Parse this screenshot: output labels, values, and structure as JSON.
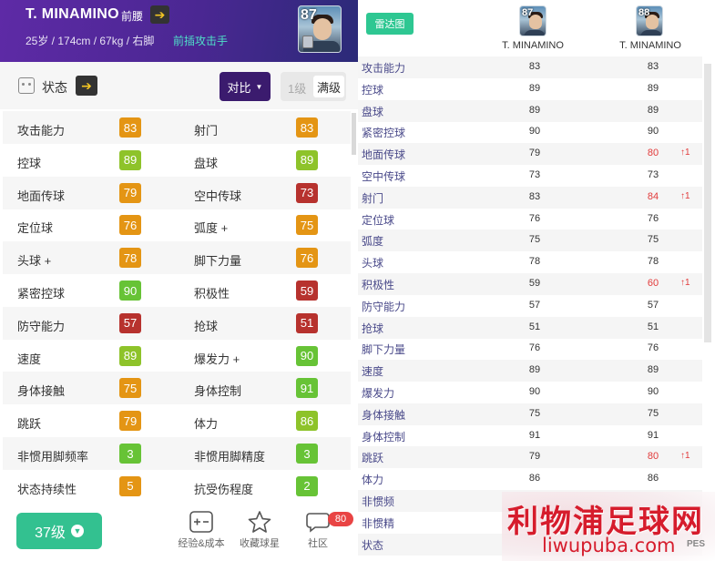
{
  "player": {
    "name": "T. MINAMINO",
    "position": "前腰",
    "info": "25岁 / 174cm / 67kg / 右脚",
    "style": "前插攻击手",
    "overall": "87"
  },
  "statebar": {
    "label": "状态",
    "compare_label": "对比",
    "level_1": "1级",
    "level_max": "满级"
  },
  "stats": [
    {
      "name": "攻击能力",
      "value": "83",
      "color": "orange"
    },
    {
      "name": "射门",
      "value": "83",
      "color": "orange"
    },
    {
      "name": "控球",
      "value": "89",
      "color": "green"
    },
    {
      "name": "盘球",
      "value": "89",
      "color": "green"
    },
    {
      "name": "地面传球",
      "value": "79",
      "color": "orange"
    },
    {
      "name": "空中传球",
      "value": "73",
      "color": "red"
    },
    {
      "name": "定位球",
      "value": "76",
      "color": "orange"
    },
    {
      "name": "弧度 +",
      "value": "75",
      "color": "orange"
    },
    {
      "name": "头球 +",
      "value": "78",
      "color": "orange"
    },
    {
      "name": "脚下力量",
      "value": "76",
      "color": "orange"
    },
    {
      "name": "紧密控球",
      "value": "90",
      "color": "lgreen"
    },
    {
      "name": "积极性",
      "value": "59",
      "color": "red"
    },
    {
      "name": "防守能力",
      "value": "57",
      "color": "red"
    },
    {
      "name": "抢球",
      "value": "51",
      "color": "red"
    },
    {
      "name": "速度",
      "value": "89",
      "color": "green"
    },
    {
      "name": "爆发力 +",
      "value": "90",
      "color": "lgreen"
    },
    {
      "name": "身体接触",
      "value": "75",
      "color": "orange"
    },
    {
      "name": "身体控制",
      "value": "91",
      "color": "lgreen"
    },
    {
      "name": "跳跃",
      "value": "79",
      "color": "orange"
    },
    {
      "name": "体力",
      "value": "86",
      "color": "green"
    },
    {
      "name": "非惯用脚频率",
      "value": "3",
      "color": "lgreen"
    },
    {
      "name": "非惯用脚精度",
      "value": "3",
      "color": "lgreen"
    },
    {
      "name": "状态持续性",
      "value": "5",
      "color": "orange"
    },
    {
      "name": "抗受伤程度",
      "value": "2",
      "color": "lgreen"
    }
  ],
  "bottom": {
    "level_button": "37级",
    "items": [
      {
        "label": "经验&成本",
        "icon": "plus-minus-icon"
      },
      {
        "label": "收藏球星",
        "icon": "star-icon"
      },
      {
        "label": "社区",
        "icon": "chat-icon"
      }
    ],
    "notification": "80"
  },
  "compare": {
    "radar_label": "雷达图",
    "players": [
      {
        "name": "T. MINAMINO",
        "overall": "87"
      },
      {
        "name": "T. MINAMINO",
        "overall": "88"
      }
    ],
    "rows": [
      {
        "name": "攻击能力",
        "v1": "83",
        "v2": "83",
        "up": false
      },
      {
        "name": "控球",
        "v1": "89",
        "v2": "89",
        "up": false
      },
      {
        "name": "盘球",
        "v1": "89",
        "v2": "89",
        "up": false
      },
      {
        "name": "紧密控球",
        "v1": "90",
        "v2": "90",
        "up": false
      },
      {
        "name": "地面传球",
        "v1": "79",
        "v2": "80",
        "up": true
      },
      {
        "name": "空中传球",
        "v1": "73",
        "v2": "73",
        "up": false
      },
      {
        "name": "射门",
        "v1": "83",
        "v2": "84",
        "up": true
      },
      {
        "name": "定位球",
        "v1": "76",
        "v2": "76",
        "up": false
      },
      {
        "name": "弧度",
        "v1": "75",
        "v2": "75",
        "up": false
      },
      {
        "name": "头球",
        "v1": "78",
        "v2": "78",
        "up": false
      },
      {
        "name": "积极性",
        "v1": "59",
        "v2": "60",
        "up": true
      },
      {
        "name": "防守能力",
        "v1": "57",
        "v2": "57",
        "up": false
      },
      {
        "name": "抢球",
        "v1": "51",
        "v2": "51",
        "up": false
      },
      {
        "name": "脚下力量",
        "v1": "76",
        "v2": "76",
        "up": false
      },
      {
        "name": "速度",
        "v1": "89",
        "v2": "89",
        "up": false
      },
      {
        "name": "爆发力",
        "v1": "90",
        "v2": "90",
        "up": false
      },
      {
        "name": "身体接触",
        "v1": "75",
        "v2": "75",
        "up": false
      },
      {
        "name": "身体控制",
        "v1": "91",
        "v2": "91",
        "up": false
      },
      {
        "name": "跳跃",
        "v1": "79",
        "v2": "80",
        "up": true
      },
      {
        "name": "体力",
        "v1": "86",
        "v2": "86",
        "up": false
      },
      {
        "name": "非惯频",
        "v1": "",
        "v2": "",
        "up": false
      },
      {
        "name": "非惯精",
        "v1": "",
        "v2": "",
        "up": false
      },
      {
        "name": "状态",
        "v1": "",
        "v2": "",
        "up": false
      }
    ],
    "up_arrow": "↑1"
  },
  "watermark": {
    "title": "利物浦足球网",
    "url": "liwupuba.com",
    "pes": "PES"
  }
}
